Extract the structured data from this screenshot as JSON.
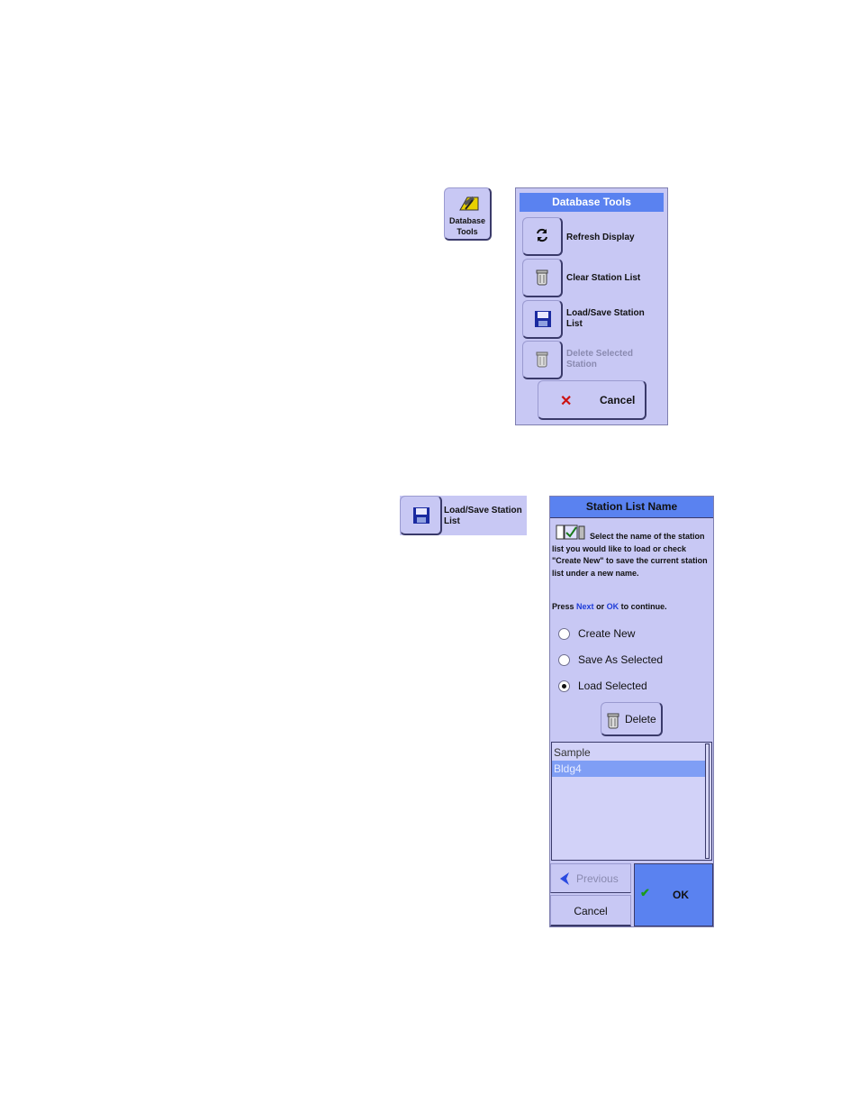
{
  "database_tools_button": {
    "label": "Database\nTools",
    "icon": "hammer-icon"
  },
  "database_tools_panel": {
    "title": "Database Tools",
    "items": [
      {
        "label": "Refresh Display",
        "icon": "refresh-icon",
        "enabled": true
      },
      {
        "label": "Clear Station List",
        "icon": "trash-can-icon",
        "enabled": true
      },
      {
        "label": "Load/Save Station List",
        "icon": "floppy-disk-icon",
        "enabled": true
      },
      {
        "label": "Delete Selected Station",
        "icon": "trash-can-icon",
        "enabled": false
      }
    ],
    "cancel_label": "Cancel",
    "cancel_icon": "red-x-icon"
  },
  "load_save_launcher": {
    "label": "Load/Save Station List",
    "icon": "floppy-disk-icon"
  },
  "station_list_dialog": {
    "title": "Station List Name",
    "description": "Select the name of the station list you would like to load or check \"Create New\" to save the current station list under a new name.",
    "press_prefix": "Press",
    "press_next": "Next",
    "press_or": "or",
    "press_ok": "OK",
    "press_suffix": "to continue.",
    "options": [
      {
        "label": "Create New",
        "selected": false
      },
      {
        "label": "Save As Selected",
        "selected": false
      },
      {
        "label": "Load Selected",
        "selected": true
      }
    ],
    "delete_label": "Delete",
    "list_items": [
      {
        "label": "Sample",
        "selected": false
      },
      {
        "label": "Bldg4",
        "selected": true
      }
    ],
    "previous_label": "Previous",
    "cancel_label": "Cancel",
    "ok_label": "OK",
    "colors": {
      "title_bar": "#5a82f0",
      "panel": "#c8c8f4",
      "keyword": "#1e3cd8",
      "selection": "#7f9ef5"
    }
  }
}
